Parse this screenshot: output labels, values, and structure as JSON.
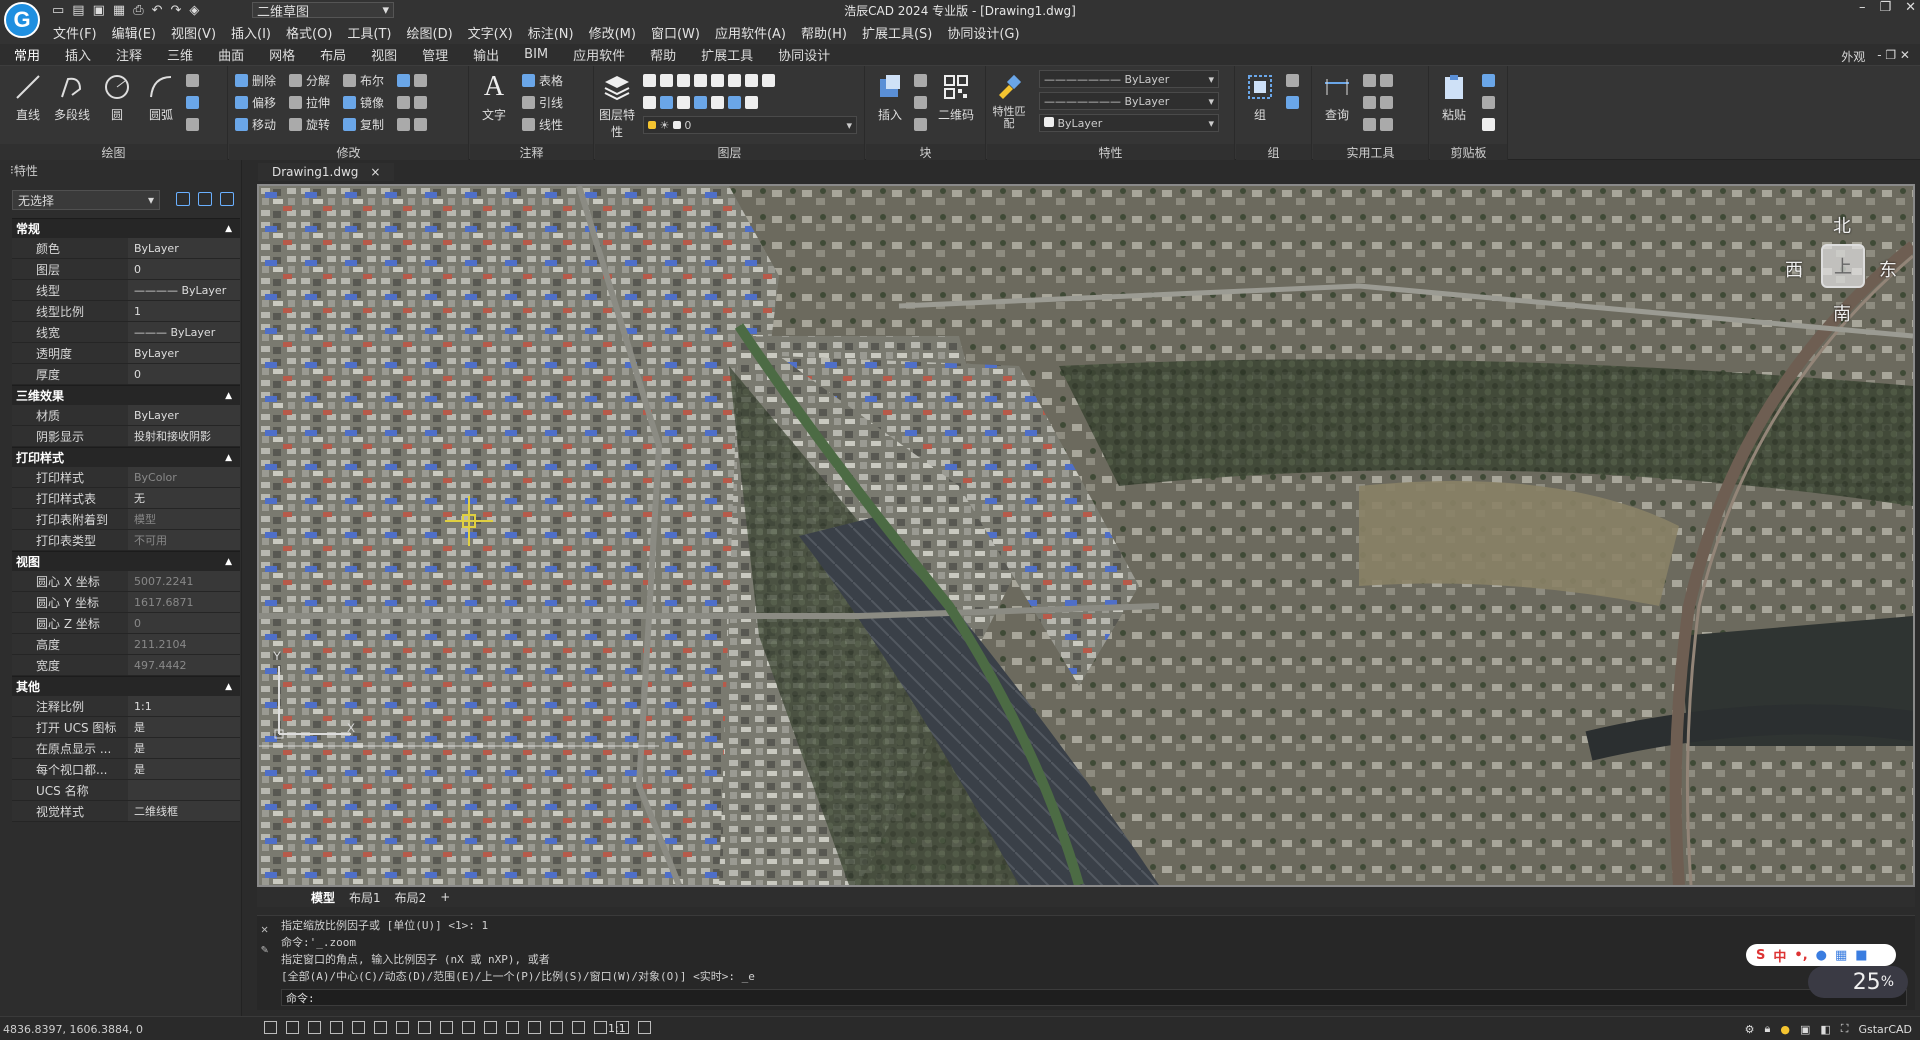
{
  "app": {
    "logo_letter": "G",
    "title": "浩辰CAD 2024 专业版 - [Drawing1.dwg]",
    "workspace": "二维草图",
    "window_controls": [
      "–",
      "❐",
      "✕"
    ]
  },
  "menu": [
    "文件(F)",
    "编辑(E)",
    "视图(V)",
    "插入(I)",
    "格式(O)",
    "工具(T)",
    "绘图(D)",
    "文字(X)",
    "标注(N)",
    "修改(M)",
    "窗口(W)",
    "应用软件(A)",
    "帮助(H)",
    "扩展工具(S)",
    "协同设计(G)"
  ],
  "ribbon_tabs": [
    "常用",
    "插入",
    "注释",
    "三维",
    "曲面",
    "网格",
    "布局",
    "视图",
    "管理",
    "输出",
    "BIM",
    "应用软件",
    "帮助",
    "扩展工具",
    "协同设计"
  ],
  "ribbon_right": {
    "appearance": "外观",
    "controls": "- ❐ ✕"
  },
  "ribbon": {
    "draw": {
      "title": "绘图",
      "line": "直线",
      "polyline": "多段线",
      "circle": "圆",
      "arc": "圆弧"
    },
    "modify": {
      "title": "修改",
      "delete": "删除",
      "explode": "分解",
      "boolean": "布尔",
      "offset": "偏移",
      "stretch": "拉伸",
      "mirror": "镜像",
      "move": "移动",
      "rotate": "旋转",
      "copy": "复制"
    },
    "annotation": {
      "title": "注释",
      "text": "文字",
      "table": "表格",
      "leader": "引线",
      "linear": "线性"
    },
    "layer": {
      "title": "图层",
      "layer_props": "图层特性",
      "current": "0"
    },
    "block": {
      "title": "块",
      "insert": "插入",
      "qrcode": "二维码"
    },
    "properties": {
      "title": "特性",
      "match": "特性匹配",
      "linetype": "ByLayer",
      "lineweight": "ByLayer",
      "color": "ByLayer"
    },
    "group": {
      "title": "组",
      "group": "组"
    },
    "utilities": {
      "title": "实用工具",
      "query": "查询"
    },
    "clipboard": {
      "title": "剪贴板",
      "paste": "粘贴"
    }
  },
  "properties_panel": {
    "header": "特性",
    "selection": "无选择",
    "sections": [
      {
        "name": "常规",
        "rows": [
          {
            "k": "颜色",
            "v": "ByLayer"
          },
          {
            "k": "图层",
            "v": "0"
          },
          {
            "k": "线型",
            "v": "———— ByLayer"
          },
          {
            "k": "线型比例",
            "v": "1"
          },
          {
            "k": "线宽",
            "v": "——— ByLayer"
          },
          {
            "k": "透明度",
            "v": "ByLayer"
          },
          {
            "k": "厚度",
            "v": "0"
          }
        ]
      },
      {
        "name": "三维效果",
        "rows": [
          {
            "k": "材质",
            "v": "ByLayer"
          },
          {
            "k": "阴影显示",
            "v": "投射和接收阴影"
          }
        ]
      },
      {
        "name": "打印样式",
        "rows": [
          {
            "k": "打印样式",
            "v": "ByColor",
            "dim": true
          },
          {
            "k": "打印样式表",
            "v": "无"
          },
          {
            "k": "打印表附着到",
            "v": "模型",
            "dim": true
          },
          {
            "k": "打印表类型",
            "v": "不可用",
            "dim": true
          }
        ]
      },
      {
        "name": "视图",
        "rows": [
          {
            "k": "圆心 X 坐标",
            "v": "5007.2241",
            "dim": true
          },
          {
            "k": "圆心 Y 坐标",
            "v": "1617.6871",
            "dim": true
          },
          {
            "k": "圆心 Z 坐标",
            "v": "0",
            "dim": true
          },
          {
            "k": "高度",
            "v": "211.2104",
            "dim": true
          },
          {
            "k": "宽度",
            "v": "497.4442",
            "dim": true
          }
        ]
      },
      {
        "name": "其他",
        "rows": [
          {
            "k": "注释比例",
            "v": "1:1"
          },
          {
            "k": "打开 UCS 图标",
            "v": "是"
          },
          {
            "k": "在原点显示 ...",
            "v": "是"
          },
          {
            "k": "每个视口都...",
            "v": "是"
          },
          {
            "k": "UCS 名称",
            "v": ""
          },
          {
            "k": "视觉样式",
            "v": "二维线框"
          }
        ]
      }
    ]
  },
  "document": {
    "tab": "Drawing1.dwg",
    "close": "×"
  },
  "viewcube": {
    "north": "北",
    "south": "南",
    "east": "东",
    "west": "西",
    "top": "上"
  },
  "layout_tabs": [
    "模型",
    "布局1",
    "布局2",
    "+"
  ],
  "command_window": {
    "history": [
      "指定缩放比例因子或 [单位(U)] <1>: 1",
      "命令:'_.zoom",
      "指定窗口的角点, 输入比例因子 (nX 或 nXP), 或者",
      "[全部(A)/中心(C)/动态(D)/范围(E)/上一个(P)/比例(S)/窗口(W)/对象(O)] <实时>: _e"
    ],
    "prompt": "命令:"
  },
  "status": {
    "coords": "4836.8397, 1606.3884, 0",
    "scale": "1:1",
    "brand": "GstarCAD"
  },
  "ime": {
    "lang": "中",
    "punct": "•,"
  },
  "zoom_badge": "25"
}
